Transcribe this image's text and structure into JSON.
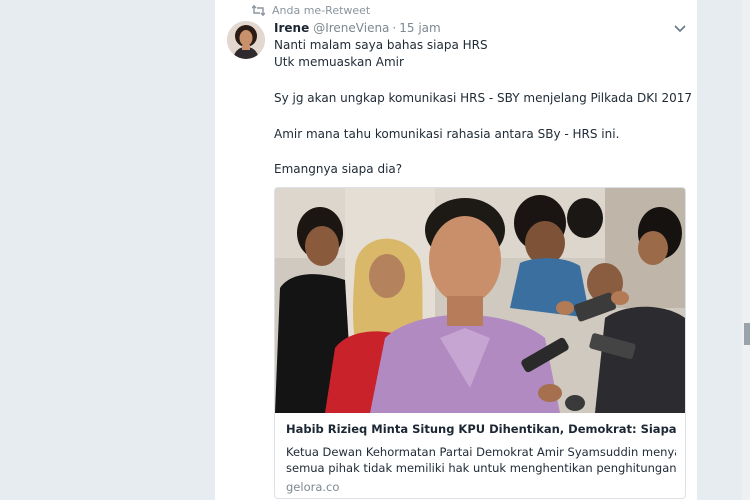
{
  "retweet": {
    "label": "Anda me-Retweet"
  },
  "tweet": {
    "name": "Irene",
    "handle": "@IreneViena",
    "separator": "·",
    "time": "15 jam",
    "lines": [
      "Nanti malam saya bahas siapa HRS",
      "Utk memuaskan Amir",
      "Sy jg akan ungkap komunikasi HRS - SBY menjelang Pilkada DKI 2017",
      "Amir mana tahu komunikasi rahasia antara SBy - HRS ini.",
      "Emangnya siapa dia?"
    ]
  },
  "card": {
    "title": "Habib Rizieq Minta Situng KPU Dihentikan, Demokrat: Siapa Dia?",
    "description_lines": [
      "Ketua Dewan Kehormatan Partai Demokrat Amir Syamsuddin menyatakan",
      "semua pihak tidak memiliki hak untuk menghentikan penghitungan suara n..."
    ],
    "domain": "gelora.co"
  },
  "colors": {
    "background": "#e6ecf0",
    "timeline": "#ffffff",
    "text": "#1c2733",
    "muted": "#7d8891",
    "retweet_green": "#17bf63"
  }
}
